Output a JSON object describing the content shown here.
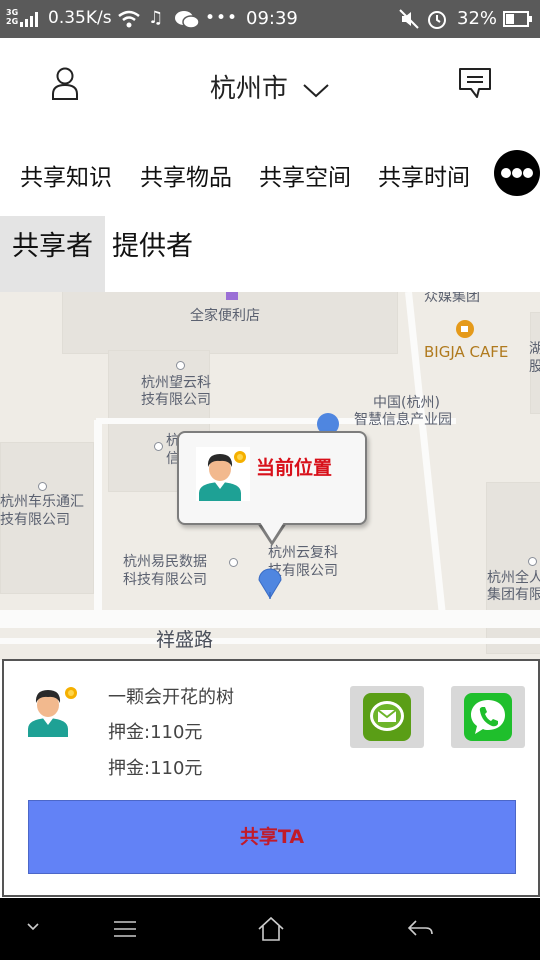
{
  "status_bar": {
    "network_top": "3G",
    "network_bottom": "2G",
    "speed": "0.35K/s",
    "time": "09:39",
    "battery": "32%",
    "icons": [
      "signal-icon",
      "wifi-icon",
      "music-icon",
      "wechat-icon",
      "more-dots-icon",
      "mute-icon",
      "alarm-icon",
      "battery-icon"
    ]
  },
  "header": {
    "city": "杭州市",
    "icons": [
      "user-icon",
      "chevron-down-icon",
      "message-icon"
    ]
  },
  "categories": {
    "items": [
      "共享知识",
      "共享物品",
      "共享空间",
      "共享时间"
    ],
    "more_icon": "more-icon"
  },
  "role_tabs": {
    "sharer": "共享者",
    "provider": "提供者",
    "active": "sharer"
  },
  "map": {
    "pois": {
      "familymart": "全家便利店",
      "media_group": "众媒集团",
      "cafe": "BIGJA CAFE",
      "partial_right": "湖\n股",
      "wangyun_1": "杭州望云科",
      "wangyun_2": "技有限公司",
      "china_hz_1": "中国(杭州)",
      "china_hz_2": "智慧信息产业园",
      "chelet_1": "杭州车乐通汇",
      "chelet_2": "技有限公司",
      "left_partial": "杭\n信",
      "behind_bubble": "技有限公司",
      "yimin_1": "杭州易民数据",
      "yimin_2": "科技有限公司",
      "yunfu_1": "杭州云复科",
      "yunfu_2": "技有限公司",
      "quanjia_1": "杭州全人",
      "quanjia_2": "集团有限"
    },
    "road": "祥盛路",
    "callout": "当前位置",
    "colors": {
      "pin": "#4f86e0",
      "callout_text": "#d8101a"
    }
  },
  "card": {
    "name": "一颗会开花的树",
    "deposit_1": "押金:110元",
    "deposit_2": "押金:110元",
    "share_button": "共享TA",
    "icons": [
      "avatar-icon",
      "sms-icon",
      "phone-icon"
    ],
    "colors": {
      "share_button_bg": "#6282f6",
      "share_button_text": "#c11b2a",
      "sms": "#5a9e16",
      "phone": "#1fbf2c"
    }
  },
  "nav_bar": {
    "icons": [
      "collapse-icon",
      "menu-icon",
      "home-icon",
      "back-icon"
    ]
  }
}
